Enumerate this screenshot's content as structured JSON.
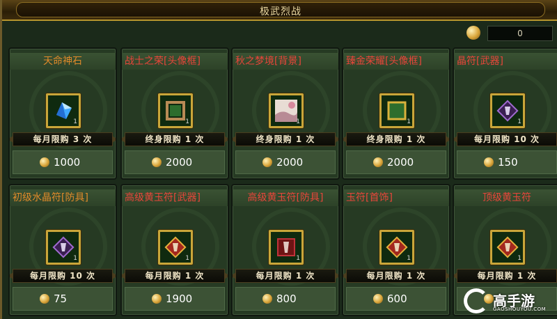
{
  "window": {
    "title": "极武烈战"
  },
  "currency": {
    "icon": "gold-coin-icon",
    "amount": "0"
  },
  "items_row1": [
    {
      "name": "天命神石",
      "color": "orange",
      "align": "center",
      "icon": "blue-crystal-icon",
      "count": "1",
      "limit": "每月限购 3 次",
      "price": "1000"
    },
    {
      "name": "战士之荣[头像框]",
      "color": "red",
      "align": "left",
      "icon": "avatar-frame-icon",
      "count": "1",
      "limit": "终身限购 1 次",
      "price": "2000"
    },
    {
      "name": "秋之梦境[背景]",
      "color": "red",
      "align": "left",
      "icon": "autumn-background-icon",
      "count": "1",
      "limit": "终身限购 1 次",
      "price": "2000"
    },
    {
      "name": "臻金荣耀[头像框]",
      "color": "red",
      "align": "left",
      "icon": "gold-avatar-frame-icon",
      "count": "1",
      "limit": "终身限购 1 次",
      "price": "2000"
    },
    {
      "name": "晶符[武器]",
      "color": "red",
      "align": "left",
      "icon": "purple-talisman-icon",
      "count": "1",
      "limit": "每月限购 10 次",
      "price": "150"
    }
  ],
  "items_row2": [
    {
      "name": "初级水晶符[防具]",
      "color": "orange",
      "align": "left",
      "icon": "purple-talisman-icon",
      "count": "1",
      "limit": "每月限购 10 次",
      "price": "75"
    },
    {
      "name": "高级黄玉符[武器]",
      "color": "red",
      "align": "left",
      "icon": "red-talisman-icon",
      "count": "1",
      "limit": "每月限购 1 次",
      "price": "1900"
    },
    {
      "name": "高级黄玉符[防具]",
      "color": "red",
      "align": "center",
      "icon": "dark-red-talisman-icon",
      "count": "1",
      "limit": "每月限购 1 次",
      "price": "800"
    },
    {
      "name": "玉符[首饰]",
      "color": "red",
      "align": "left",
      "icon": "red-talisman-icon",
      "count": "1",
      "limit": "每月限购 1 次",
      "price": "600"
    },
    {
      "name": "顶级黄玉符",
      "color": "red",
      "align": "center",
      "icon": "red-talisman-icon",
      "count": "1",
      "limit": "每月限购 1 次",
      "price": ""
    }
  ],
  "watermark": {
    "brand": "高手游",
    "sub": "GAOSHOUYOU.COM"
  }
}
